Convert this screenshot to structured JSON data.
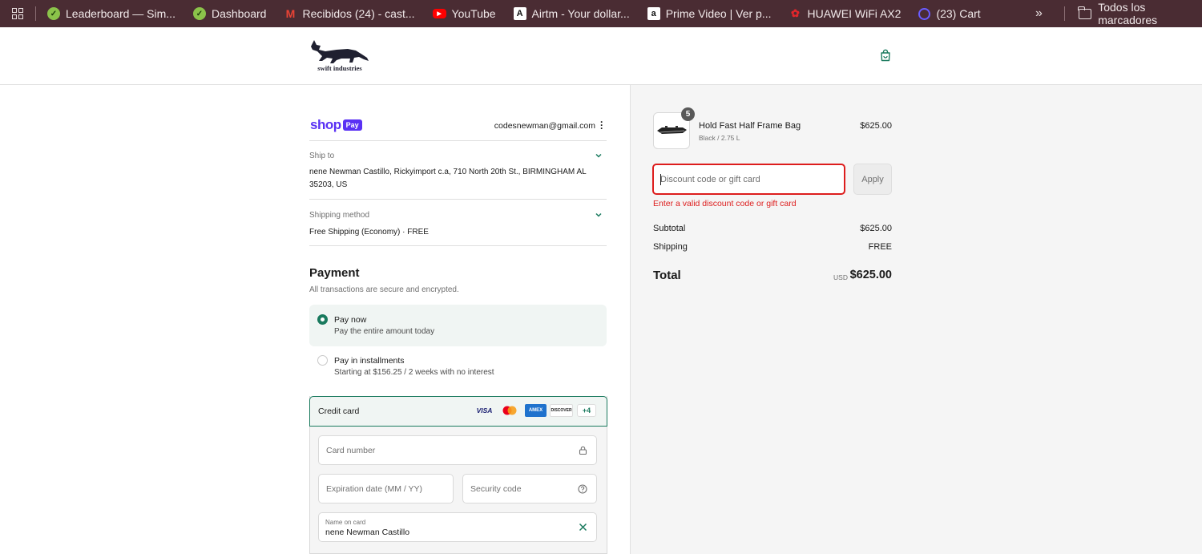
{
  "bookmarks": {
    "items": [
      {
        "label": "Leaderboard — Sim...",
        "icon": "leaf-icon"
      },
      {
        "label": "Dashboard",
        "icon": "leaf-icon"
      },
      {
        "label": "Recibidos (24) - cast...",
        "icon": "gmail-icon"
      },
      {
        "label": "YouTube",
        "icon": "youtube-icon"
      },
      {
        "label": "Airtm - Your dollar...",
        "icon": "airtm-icon"
      },
      {
        "label": "Prime Video | Ver p...",
        "icon": "amazon-icon"
      },
      {
        "label": "HUAWEI WiFi AX2",
        "icon": "huawei-icon"
      },
      {
        "label": "(23) Cart",
        "icon": "cart-app-icon"
      }
    ],
    "more": "»",
    "folder_label": "Todos los marcadores"
  },
  "header": {
    "brand": "swift industries"
  },
  "shop_pay": {
    "text": "shop",
    "badge": "Pay",
    "email": "codesnewman@gmail.com"
  },
  "ship_to": {
    "label": "Ship to",
    "address": "nene Newman Castillo, Rickyimport c.a, 710 North 20th St., BIRMINGHAM AL 35203, US"
  },
  "shipping_method": {
    "label": "Shipping method",
    "value": "Free Shipping (Economy) · FREE"
  },
  "payment": {
    "title": "Payment",
    "subtitle": "All transactions are secure and encrypted.",
    "options": [
      {
        "title": "Pay now",
        "subtitle": "Pay the entire amount today",
        "selected": true
      },
      {
        "title": "Pay in installments",
        "subtitle": "Starting at $156.25 / 2 weeks with no interest",
        "selected": false
      }
    ],
    "credit_card": {
      "label": "Credit card",
      "logos": [
        "VISA",
        "MC",
        "AMEX",
        "DISCOVER"
      ],
      "more_count": "+4",
      "card_number_placeholder": "Card number",
      "expiration_placeholder": "Expiration date (MM / YY)",
      "security_placeholder": "Security code",
      "name_label": "Name on card",
      "name_value": "nene Newman Castillo"
    }
  },
  "order": {
    "item": {
      "quantity": "5",
      "name": "Hold Fast Half Frame Bag",
      "variant": "Black / 2.75 L",
      "price": "$625.00"
    },
    "discount": {
      "placeholder": "Discount code or gift card",
      "apply_label": "Apply",
      "error": "Enter a valid discount code or gift card"
    },
    "subtotal_label": "Subtotal",
    "subtotal_value": "$625.00",
    "shipping_label": "Shipping",
    "shipping_value": "FREE",
    "total_label": "Total",
    "currency": "USD",
    "total_value": "$625.00"
  },
  "colors": {
    "bookmark_bar": "#4a2c33",
    "accent_green": "#1a7a5e",
    "shop_pay_purple": "#5a31f4",
    "error_red": "#dd1d1d"
  }
}
